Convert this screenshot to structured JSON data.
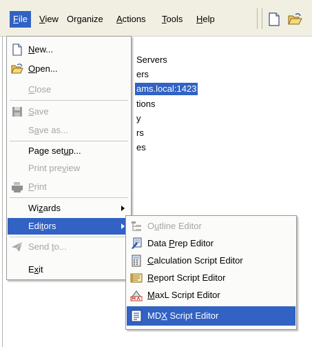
{
  "menubar": {
    "items": [
      {
        "label": "File",
        "mnemonic": "F"
      },
      {
        "label": "View",
        "mnemonic": "V"
      },
      {
        "label": "Organize",
        "mnemonic": "g"
      },
      {
        "label": "Actions",
        "mnemonic": "A"
      },
      {
        "label": "Tools",
        "mnemonic": "T"
      },
      {
        "label": "Help",
        "mnemonic": "H"
      }
    ],
    "toolbar_icons": [
      "new-document-icon",
      "open-folder-icon"
    ]
  },
  "tree": {
    "lines": [
      {
        "text": "Servers"
      },
      {
        "text": "ers"
      },
      {
        "text": "ams.local:1423",
        "selected": true
      },
      {
        "text": "tions"
      },
      {
        "text": "y"
      },
      {
        "text": "rs"
      },
      {
        "text": "es"
      }
    ]
  },
  "file_menu": {
    "items": [
      {
        "pre": "",
        "u": "N",
        "post": "ew...",
        "icon": "new-document-icon",
        "enabled": true
      },
      {
        "pre": "",
        "u": "O",
        "post": "pen...",
        "icon": "open-folder-icon",
        "enabled": true
      },
      {
        "pre": "",
        "u": "C",
        "post": "lose",
        "icon": "",
        "enabled": false
      },
      {
        "pre": "",
        "u": "S",
        "post": "ave",
        "icon": "save-icon",
        "enabled": false
      },
      {
        "pre": "S",
        "u": "a",
        "post": "ve as...",
        "icon": "",
        "enabled": false
      },
      {
        "pre": "Page set",
        "u": "u",
        "post": "p...",
        "icon": "",
        "enabled": true
      },
      {
        "pre": "Print pre",
        "u": "v",
        "post": "iew",
        "icon": "",
        "enabled": false
      },
      {
        "pre": "",
        "u": "P",
        "post": "rint",
        "icon": "print-icon",
        "enabled": false
      },
      {
        "pre": "Wi",
        "u": "z",
        "post": "ards",
        "icon": "",
        "enabled": true,
        "submenu": true
      },
      {
        "pre": "Edi",
        "u": "t",
        "post": "ors",
        "icon": "",
        "enabled": true,
        "submenu": true,
        "highlighted": true
      },
      {
        "pre": "Send ",
        "u": "t",
        "post": "o...",
        "icon": "send-icon",
        "enabled": false
      },
      {
        "pre": "E",
        "u": "x",
        "post": "it",
        "icon": "",
        "enabled": true
      }
    ]
  },
  "editors_submenu": {
    "items": [
      {
        "pre": "O",
        "u": "u",
        "post": "tline Editor",
        "icon": "outline-editor-icon",
        "enabled": false
      },
      {
        "pre": "Data ",
        "u": "P",
        "post": "rep Editor",
        "icon": "data-prep-editor-icon",
        "enabled": true
      },
      {
        "pre": "",
        "u": "C",
        "post": "alculation Script Editor",
        "icon": "calculation-script-editor-icon",
        "enabled": true
      },
      {
        "pre": "",
        "u": "R",
        "post": "eport Script Editor",
        "icon": "report-script-editor-icon",
        "enabled": true
      },
      {
        "pre": "",
        "u": "M",
        "post": "axL Script Editor",
        "icon": "maxl-script-editor-icon",
        "enabled": true
      },
      {
        "pre": "MD",
        "u": "X",
        "post": " Script Editor",
        "icon": "mdx-script-editor-icon",
        "enabled": true,
        "highlighted": true
      }
    ]
  },
  "colors": {
    "highlight": "#3162c4",
    "menubar_bg": "#f1efe2",
    "menu_bg": "#fbfbf9",
    "disabled_text": "#a6a6a6"
  }
}
